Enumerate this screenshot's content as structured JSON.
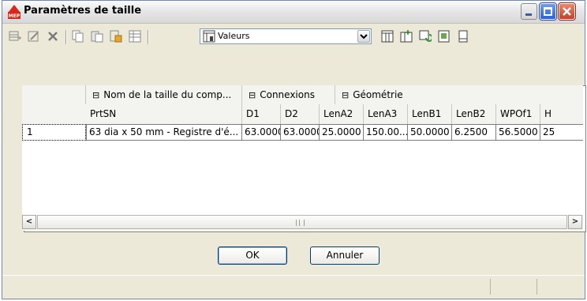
{
  "window": {
    "title": "Paramètres de taille",
    "app_badge": "MEP"
  },
  "toolbar": {
    "view_label": "Valeurs",
    "icons": [
      "add-row-icon",
      "edit-row-icon",
      "delete-icon",
      "copy-icon",
      "paste-icon",
      "paste-special-icon",
      "table-icon",
      "view-icon",
      "column-icon",
      "add-column-icon",
      "refresh-icon",
      "export-icon",
      "page-icon"
    ]
  },
  "grid": {
    "groups": [
      {
        "label": "Nom de la taille du comp..."
      },
      {
        "label": "Connexions"
      },
      {
        "label": "Géométrie"
      }
    ],
    "group_symbol": "⊟",
    "columns": [
      "PrtSN",
      "D1",
      "D2",
      "LenA2",
      "LenA3",
      "LenB1",
      "LenB2",
      "WPOf1",
      "H"
    ],
    "rows": [
      {
        "index": "1",
        "cells": [
          "63 dia x 50 mm - Registre d'é...",
          "63.0000",
          "63.0000",
          "25.0000",
          "150.00...",
          "50.0000",
          "6.2500",
          "56.5000",
          "25"
        ]
      }
    ]
  },
  "scrollbar": {
    "left_arrow": "<",
    "right_arrow": ">"
  },
  "buttons": {
    "ok": "OK",
    "cancel": "Annuler"
  },
  "colors": {
    "titlebar": "#e5e5e5",
    "close": "#c3402a",
    "maximize": "#2a5fd6",
    "dialog_bg": "#ece9d8"
  }
}
